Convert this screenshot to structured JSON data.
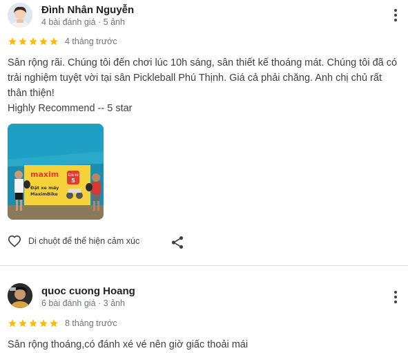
{
  "reviews": [
    {
      "author": "Đình Nhân Nguyễn",
      "meta": "4 bài đánh giá · 5 ảnh",
      "rating": 5,
      "time": "4 tháng trước",
      "text": "Sân rộng rãi. Chúng tôi đến chơi lúc 10h sáng, sân thiết kế thoáng mát. Chúng tôi đã có trải nghiệm tuyệt vời tại sân Pickleball Phú Thịnh. Giá cả phải chăng. Anh chị chủ rất thân thiện!\nHighly Recommend -- 5 star",
      "photo": {
        "banner_brand": "maxim",
        "banner_line1": "Đặt xe máy",
        "banner_line2": "MaximBike",
        "promo_text": "Giá từ",
        "promo_value": "5"
      },
      "react_label": "Di chuột để thể hiện cảm xúc"
    },
    {
      "author": "quoc cuong Hoang",
      "meta": "6 bài đánh giá · 3 ảnh",
      "rating": 5,
      "time": "8 tháng trước",
      "text": "Sân rộng thoáng,có đánh xé vé nên giờ giấc thoải mái"
    }
  ],
  "colors": {
    "star": "#fbbc04",
    "banner_yellow": "#f6d23a",
    "court_teal": "#1b8fb0",
    "maxim_red": "#e53935"
  }
}
